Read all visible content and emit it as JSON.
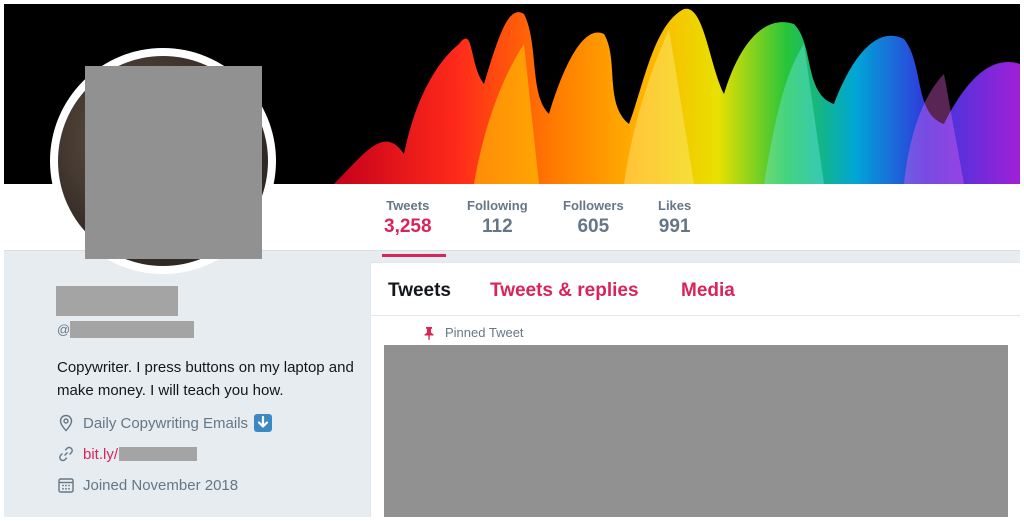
{
  "stats": [
    {
      "label": "Tweets",
      "value": "3,258",
      "active": true
    },
    {
      "label": "Following",
      "value": "112",
      "active": false
    },
    {
      "label": "Followers",
      "value": "605",
      "active": false
    },
    {
      "label": "Likes",
      "value": "991",
      "active": false
    }
  ],
  "profile": {
    "handle_prefix": "@",
    "bio": "Copywriter. I press buttons on my laptop and make money. I will teach you how.",
    "location": "Daily Copywriting Emails",
    "location_emoji": "down-arrow-button",
    "link": "bit.ly/",
    "joined": "Joined November 2018"
  },
  "timeline": {
    "tabs": [
      {
        "label": "Tweets",
        "active": true
      },
      {
        "label": "Tweets & replies",
        "active": false
      },
      {
        "label": "Media",
        "active": false
      }
    ],
    "pinned_label": "Pinned Tweet"
  },
  "colors": {
    "accent": "#d9245a",
    "stat_label": "#657786",
    "background": "#e6ecf0",
    "redaction": "#919191"
  }
}
